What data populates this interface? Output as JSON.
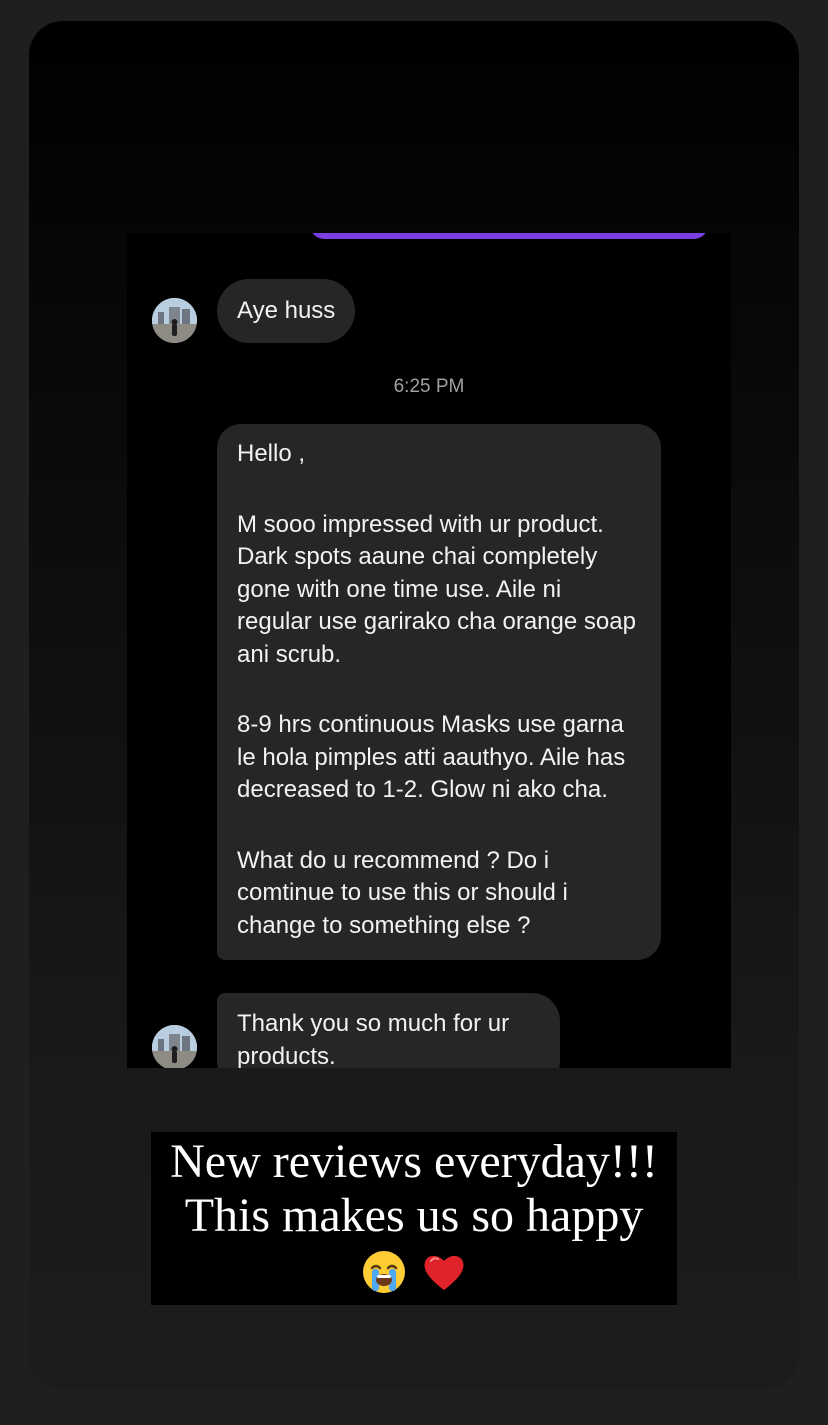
{
  "chat": {
    "messages": [
      {
        "text": "Aye huss"
      },
      {
        "paragraphs": [
          "Hello ,",
          "M sooo impressed with ur product. Dark spots aaune chai completely gone with one time use. Aile ni regular use garirako cha orange soap ani scrub.",
          "8-9 hrs continuous Masks use garna le hola pimples atti aauthyo. Aile has decreased to 1-2. Glow ni ako cha.",
          "What do u recommend ? Do i comtinue to use this or should i change to something else ?"
        ]
      },
      {
        "text": "Thank you so much for ur products."
      }
    ],
    "timestamp": "6:25 PM",
    "sent_bubble_color": "#7a3fe0",
    "received_bubble_color": "#262626"
  },
  "caption": {
    "line1": "New reviews everyday!!!",
    "line2": "This makes us so happy",
    "emojis": [
      "loudly-crying-face-emoji",
      "red-heart-emoji"
    ]
  },
  "icons": {
    "avatar": "profile-photo-avatar"
  }
}
